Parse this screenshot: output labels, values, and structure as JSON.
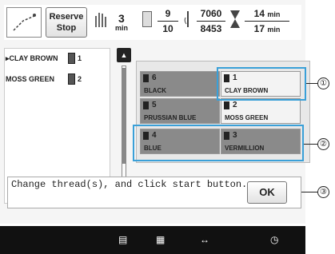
{
  "header": {
    "reserve_stop_label_1": "Reserve",
    "reserve_stop_label_2": "Stop",
    "stitch_count": "3",
    "stitch_unit": "min",
    "thread_progress_num": "9",
    "thread_progress_den": "10",
    "stitch_progress_num": "7060",
    "stitch_progress_den": "8453",
    "time_num": "14",
    "time_num_unit": "min",
    "time_den": "17",
    "time_den_unit": "min"
  },
  "thread_list": [
    {
      "name": "▸CLAY BROWN",
      "number": "1"
    },
    {
      "name": "MOSS GREEN",
      "number": "2"
    }
  ],
  "thread_grid": [
    {
      "number": "6",
      "name": "BLACK",
      "style": "dark"
    },
    {
      "number": "1",
      "name": "CLAY BROWN",
      "style": "light"
    },
    {
      "number": "5",
      "name": "PRUSSIAN BLUE",
      "style": "dark"
    },
    {
      "number": "2",
      "name": "MOSS GREEN",
      "style": "light"
    },
    {
      "number": "4",
      "name": "BLUE",
      "style": "dark"
    },
    {
      "number": "3",
      "name": "VERMILLION",
      "style": "dark"
    }
  ],
  "scroll": {
    "up": "▲",
    "down": "▼"
  },
  "message": {
    "text": "Change thread(s), and click start button.",
    "ok_label": "OK"
  },
  "callouts": [
    "①",
    "②",
    "③"
  ],
  "bottom_bar": {
    "icon_1": "▤",
    "icon_2": "▦",
    "icon_3": "↔",
    "icon_4": "◷"
  },
  "colors": {
    "highlight": "#3aa0d8",
    "bottom_bar": "#111111"
  }
}
